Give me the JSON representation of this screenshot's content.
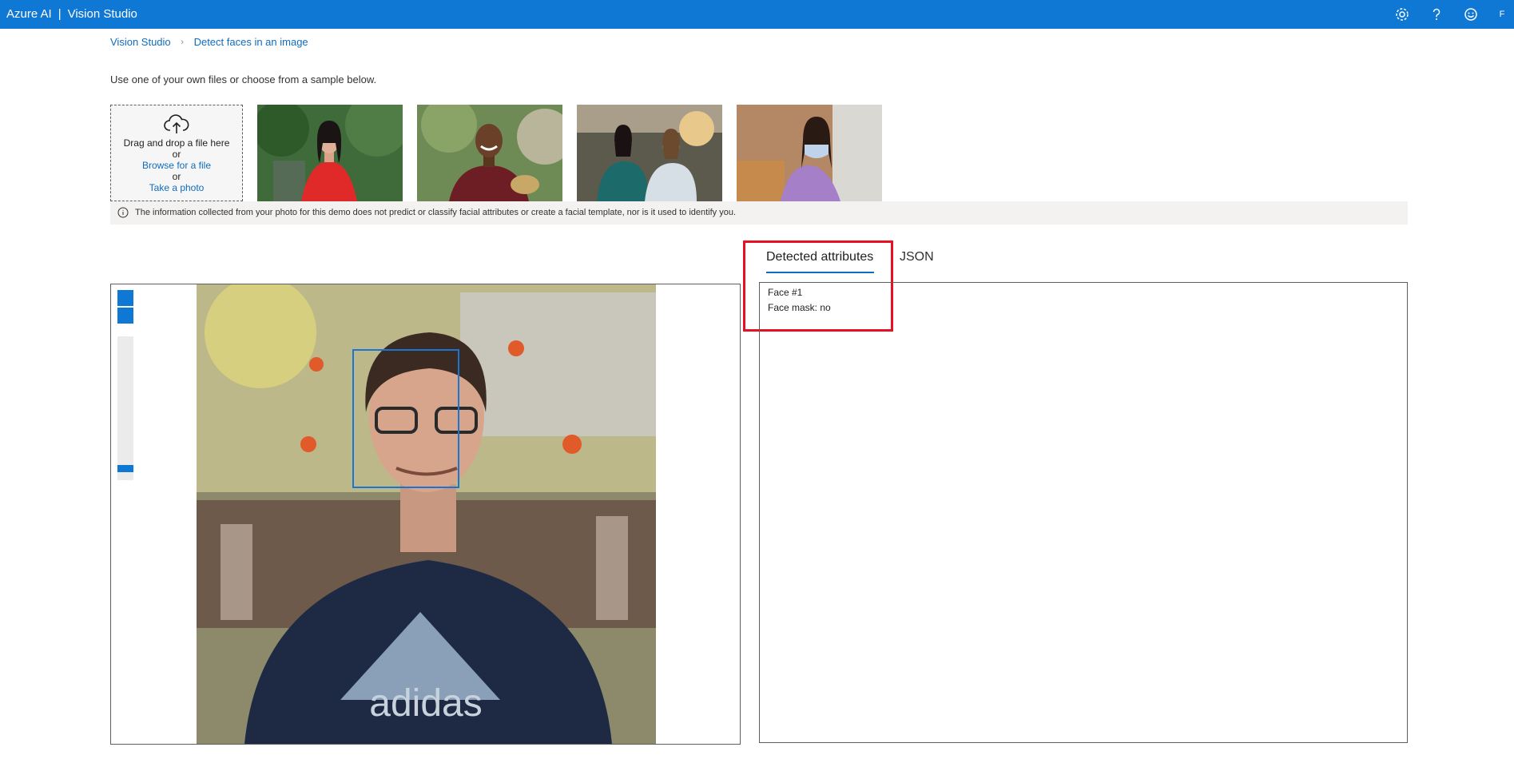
{
  "header": {
    "product": "Azure AI",
    "separator": "|",
    "app": "Vision Studio",
    "avatar_initial": "F",
    "icons": [
      "settings-icon",
      "help-icon",
      "feedback-smiley-icon"
    ]
  },
  "breadcrumb": {
    "root": "Vision Studio",
    "current": "Detect faces in an image"
  },
  "instructions": "Use one of your own files or choose from a sample below.",
  "upload": {
    "line1": "Drag and drop a file here",
    "or1": "or",
    "browse": "Browse for a file",
    "or2": "or",
    "photo": "Take a photo"
  },
  "samples": [
    {
      "id": "sample-woman-red-dress"
    },
    {
      "id": "sample-man-smiling"
    },
    {
      "id": "sample-two-women-office"
    },
    {
      "id": "sample-woman-face-mask"
    }
  ],
  "info_text": "The information collected from your photo for this demo does not predict or classify facial attributes or create a facial template, nor is it used to identify you.",
  "tabs": {
    "detected": "Detected attributes",
    "json": "JSON"
  },
  "results": {
    "face_label": "Face #1",
    "mask_line": "Face mask: no"
  },
  "colors": {
    "topbar": "#0f78d4",
    "link": "#0f6cbd",
    "highlight": "#e81123",
    "facebox": "#1a75d2"
  }
}
